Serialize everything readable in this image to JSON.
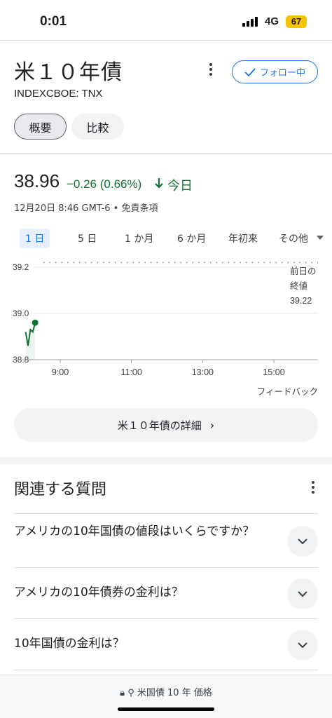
{
  "status": {
    "time": "0:01",
    "network": "4G",
    "battery": "67"
  },
  "header": {
    "title": "米１０年債",
    "ticker": "INDEXCBOE: TNX",
    "follow_label": "フォロー中",
    "chips": {
      "overview": "概要",
      "compare": "比較"
    }
  },
  "quote": {
    "price": "38.96",
    "change": "−0.26 (0.66%)",
    "period": "今日",
    "timestamp": "12月20日 8:46 GMT-6 • 免責条項",
    "direction": "down",
    "color": "#137333"
  },
  "range_tabs": [
    "1 日",
    "5 日",
    "1 か月",
    "6 か月",
    "年初来",
    "その他"
  ],
  "chart_data": {
    "type": "line",
    "yticks": [
      "39.2",
      "39.0",
      "38.8"
    ],
    "xticks": [
      "9:00",
      "11:00",
      "13:00",
      "15:00"
    ],
    "ylim": [
      38.8,
      39.2
    ],
    "series": [
      {
        "x": [
          "8:30",
          "8:34",
          "8:38",
          "8:42",
          "8:46"
        ],
        "values": [
          38.92,
          38.86,
          38.93,
          38.92,
          38.96
        ],
        "color": "#137333"
      }
    ],
    "previous_close": {
      "label_lines": [
        "前日の",
        "終値"
      ],
      "value": "39.22"
    }
  },
  "feedback_label": "フィードバック",
  "detail_button": "米１０年債の詳細",
  "related": {
    "title": "関連する質問",
    "questions": [
      "アメリカの10年国債の値段はいくらですか？",
      "アメリカの10年債券の金利は？",
      "10年国債の金利は？"
    ]
  },
  "url_bar": {
    "text": "米国債 10 年 価格"
  }
}
